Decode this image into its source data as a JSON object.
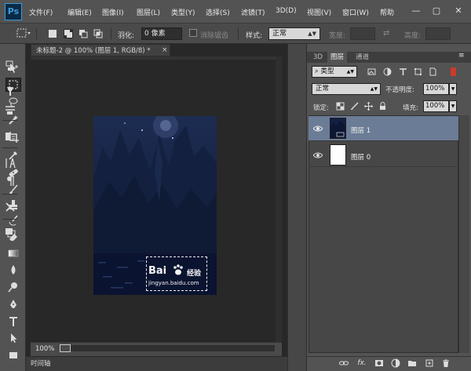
{
  "app": {
    "logo": "Ps"
  },
  "menu": [
    "文件(F)",
    "编辑(E)",
    "图像(I)",
    "图层(L)",
    "类型(Y)",
    "选择(S)",
    "滤镜(T)",
    "3D(D)",
    "视图(V)",
    "窗口(W)",
    "帮助"
  ],
  "window_controls": {
    "minimize": "—",
    "restore": "▢",
    "close": "✕"
  },
  "options": {
    "feather_label": "羽化:",
    "feather_value": "0 像素",
    "antialias_label": "消除锯齿",
    "style_label": "样式:",
    "style_value": "正常",
    "width_label": "宽度:",
    "height_label": "高度:",
    "swap_icon": "⇄"
  },
  "document": {
    "tab_title": "未标题-2 @ 100% (图层 1, RGB/8) *",
    "close": "×",
    "zoom": "100%",
    "timeline_tab": "时间轴"
  },
  "watermark": {
    "logo_text": "Bai",
    "logo_text2": "经验",
    "url": "jingyan.baidu.com"
  },
  "panel": {
    "tabs": [
      "3D",
      "图层",
      "通道"
    ],
    "menu_icon": "≡",
    "filter_kind": "类型",
    "blend_mode": "正常",
    "opacity_label": "不透明度:",
    "opacity_value": "100%",
    "lock_label": "锁定:",
    "fill_label": "填充:",
    "fill_value": "100%",
    "layers": [
      {
        "name": "图层 1",
        "selected": true
      },
      {
        "name": "图层 0",
        "selected": false
      }
    ],
    "bottom_icons": [
      "link-icon",
      "fx-icon",
      "mask-icon",
      "adjustment-icon",
      "group-icon",
      "new-layer-icon",
      "trash-icon"
    ],
    "fx_label": "fx."
  },
  "colors": {
    "accent": "#3d9ad6",
    "selected_layer": "#6b7c96",
    "panel_bg": "#535353"
  }
}
